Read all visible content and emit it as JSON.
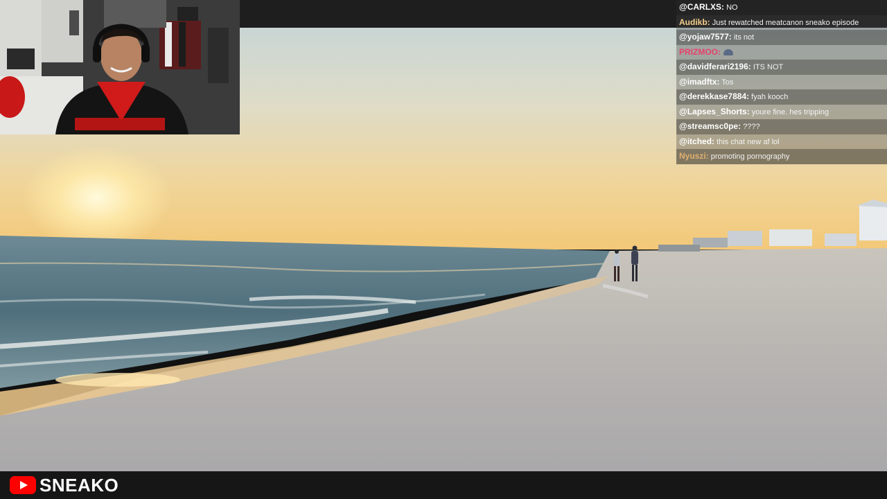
{
  "brand": {
    "name": "SNEAKO",
    "logo_icon": "youtube-logo-icon",
    "logo_color": "#ff0000"
  },
  "chat": {
    "messages": [
      {
        "user": "@CARLXS:",
        "text": "NO",
        "color": "#ffffff"
      },
      {
        "user": "Audikb:",
        "text": "Just rewatched meatcanon sneako episode",
        "color": "#f5d08a"
      },
      {
        "user": "@yojaw7577:",
        "text": "its not",
        "color": "#ffffff"
      },
      {
        "user": "PRIZMOO:",
        "text": "",
        "color": "#e8426b",
        "emote": "hooded-emote-icon"
      },
      {
        "user": "@davidferari2196:",
        "text": "ITS NOT",
        "color": "#ffffff"
      },
      {
        "user": "@imadftx:",
        "text": "Tos",
        "color": "#ffffff"
      },
      {
        "user": "@derekkase7884:",
        "text": "fyah kooch",
        "color": "#ffffff"
      },
      {
        "user": "@Lapses_Shorts:",
        "text": "youre fine. hes tripping",
        "color": "#ffffff"
      },
      {
        "user": "@streamsc0pe:",
        "text": "????",
        "color": "#ffffff"
      },
      {
        "user": "@itched:",
        "text": "this chat new af lol",
        "color": "#ffffff"
      },
      {
        "user": "Nyuszi:",
        "text": "promoting pornography",
        "color": "#e0b070"
      }
    ]
  }
}
